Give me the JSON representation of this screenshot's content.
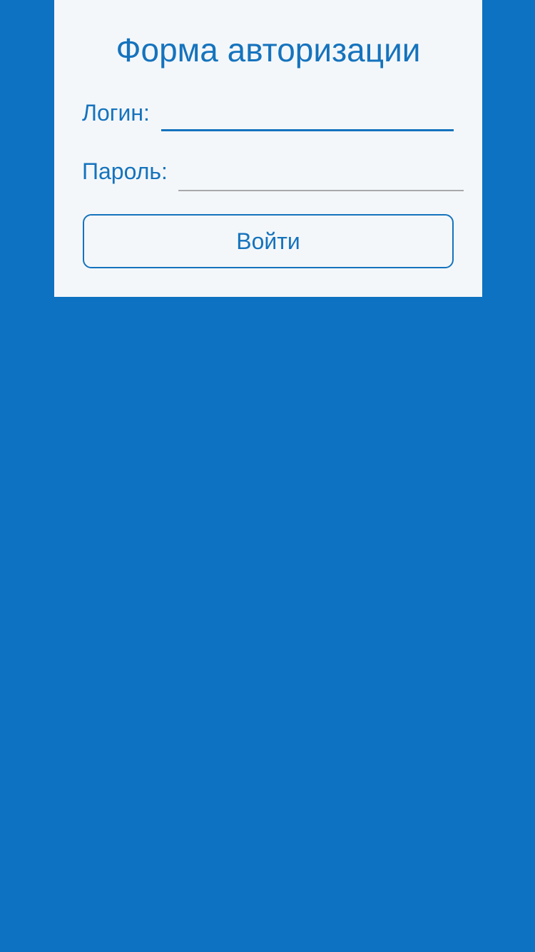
{
  "form": {
    "title": "Форма авторизации",
    "login_label": "Логин:",
    "login_value": "",
    "password_label": "Пароль:",
    "password_value": "",
    "submit_label": "Войти"
  },
  "colors": {
    "background": "#0d72c1",
    "card": "#f4f7fa",
    "accent": "#1573bd",
    "inactive_underline": "#a9a9a9"
  }
}
